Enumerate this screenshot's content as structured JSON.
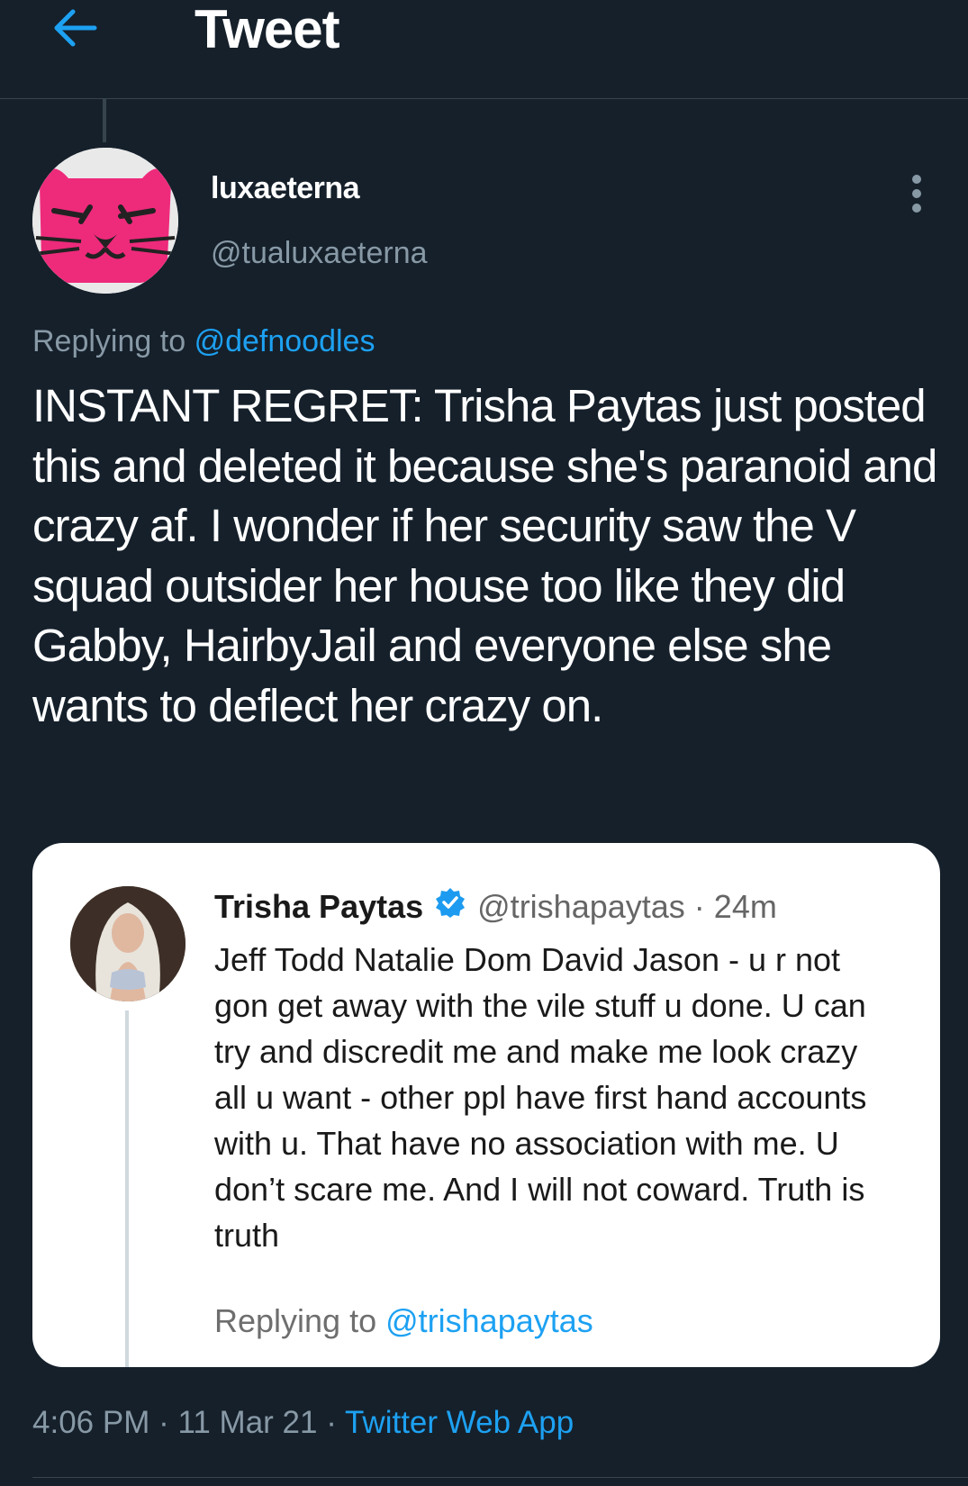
{
  "header": {
    "title": "Tweet",
    "back_icon": "arrow-left-icon"
  },
  "tweet": {
    "author_name": "luxaeterna",
    "author_handle": "@tualuxaeterna",
    "replying_prefix": "Replying to",
    "replying_handle": "@defnoodles",
    "text": "INSTANT REGRET: Trisha Paytas just posted this and deleted it because she's paranoid and crazy af. I wonder if her security saw the V squad outsider her house too like they did Gabby, HairbyJail and everyone else she wants to deflect her crazy on.",
    "time": "4:06 PM",
    "date": "11 Mar 21",
    "source": "Twitter Web App"
  },
  "quote": {
    "name": "Trisha Paytas",
    "handle": "@trishapaytas",
    "age": "24m",
    "text": "Jeff Todd Natalie Dom David Jason - u r not gon get away with the vile stuff u done. U can try and discredit me and make me look crazy all u want - other ppl have first hand accounts with u. That have no association with me. U don’t scare me. And I will not coward. Truth is truth",
    "replying_prefix": "Replying to",
    "replying_handle": "@trishapaytas"
  },
  "colors": {
    "background": "#15202b",
    "accent": "#1da1f2",
    "secondary_text": "#8899a6",
    "card_background": "#ffffff"
  }
}
